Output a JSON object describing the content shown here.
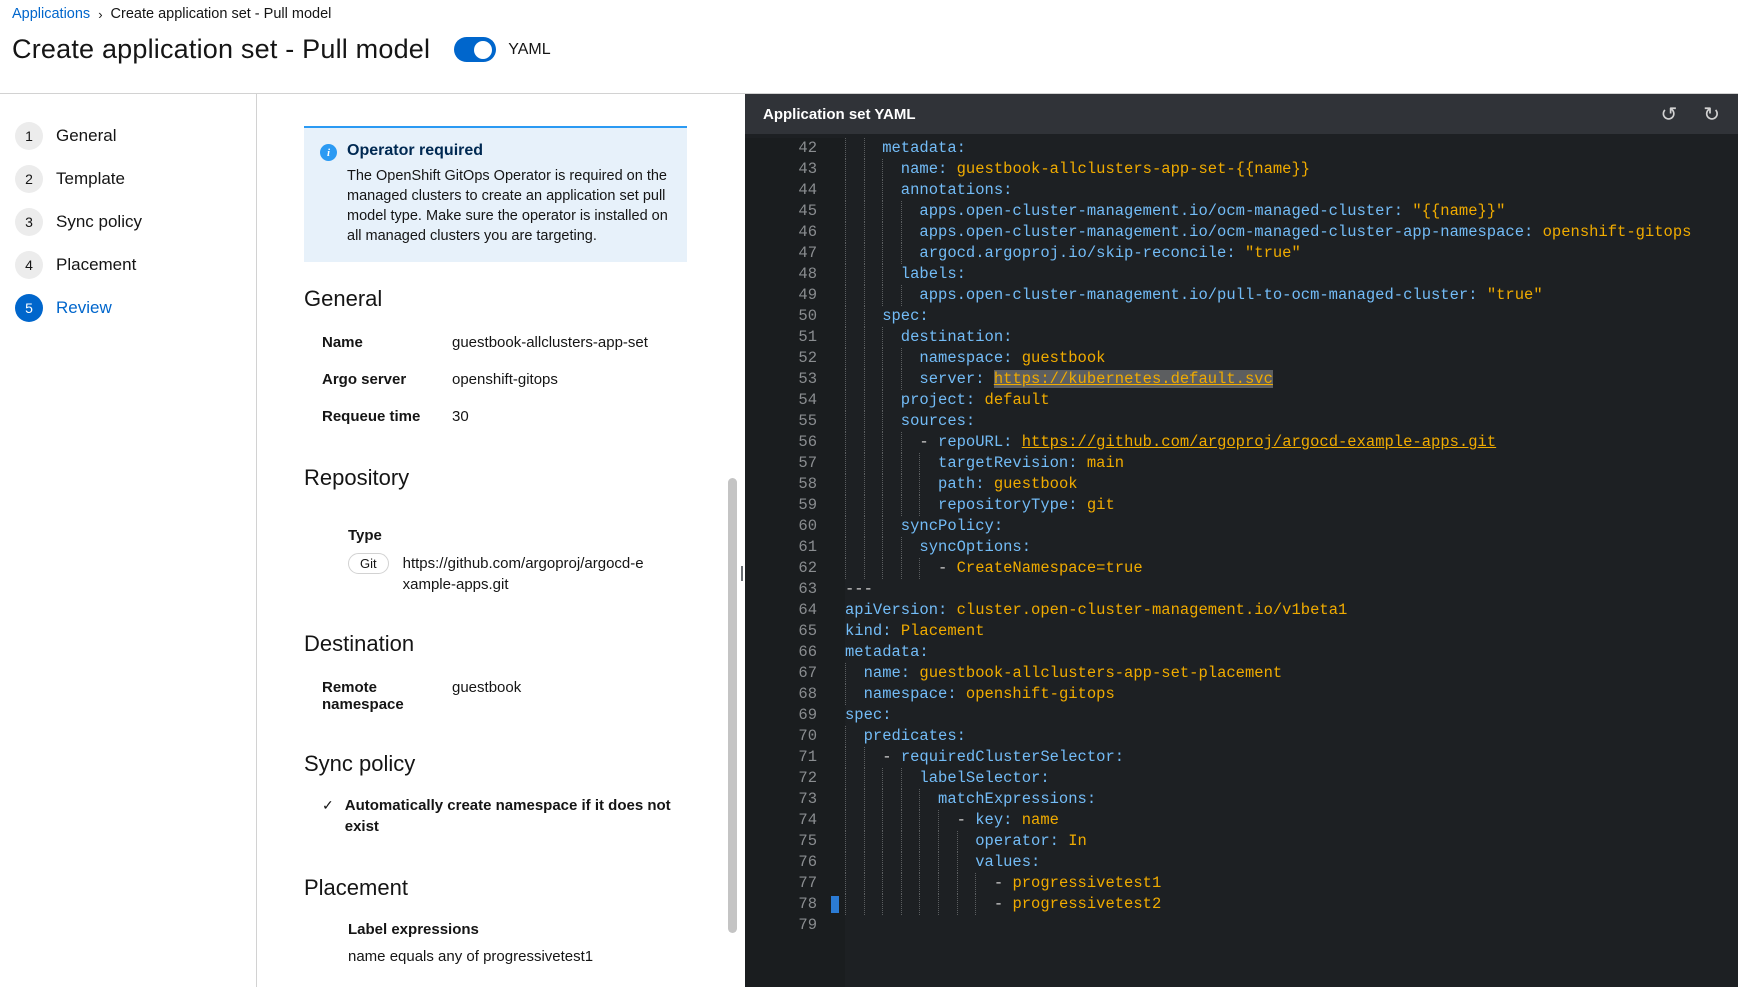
{
  "breadcrumb": {
    "link": "Applications",
    "separator": "›",
    "current": "Create application set - Pull model"
  },
  "header": {
    "title": "Create application set - Pull model",
    "toggle_label": "YAML",
    "toggle_on": true
  },
  "wizard": {
    "active_step": "5",
    "steps": [
      {
        "num": "1",
        "label": "General"
      },
      {
        "num": "2",
        "label": "Template"
      },
      {
        "num": "3",
        "label": "Sync policy"
      },
      {
        "num": "4",
        "label": "Placement"
      },
      {
        "num": "5",
        "label": "Review"
      }
    ]
  },
  "review": {
    "alert": {
      "icon": "info-circle-icon",
      "title": "Operator required",
      "body": "The OpenShift GitOps Operator is required on the managed clusters to create an application set pull model type. Make sure the operator is installed on all managed clusters you are targeting."
    },
    "general": {
      "heading": "General",
      "fields": [
        {
          "label": "Name",
          "value": "guestbook-allclusters-app-set"
        },
        {
          "label": "Argo server",
          "value": "openshift-gitops"
        },
        {
          "label": "Requeue time",
          "value": "30"
        }
      ]
    },
    "repository": {
      "heading": "Repository",
      "type_label": "Type",
      "type_chip": "Git",
      "url": "https://github.com/argoproj/argocd-example-apps.git"
    },
    "destination": {
      "heading": "Destination",
      "fields": [
        {
          "label": "Remote namespace",
          "value": "guestbook"
        }
      ]
    },
    "sync_policy": {
      "heading": "Sync policy",
      "check_glyph": "✓",
      "item": "Automatically create namespace if it does not exist"
    },
    "placement": {
      "heading": "Placement",
      "label": "Label expressions",
      "value_partial": "name equals any of progressivetest1"
    }
  },
  "editor": {
    "title": "Application set YAML",
    "undo_glyph": "↺",
    "redo_glyph": "↻",
    "cursor_line": 78,
    "colors": {
      "background": "#1d2023",
      "key": "#73bcf7",
      "value": "#f0ab00",
      "plain": "#d2d2d2",
      "line_number": "#8a8d90",
      "cursor": "#2b7bd4"
    },
    "lines": [
      {
        "n": 42,
        "s": [
          [
            "k",
            "    metadata:"
          ]
        ]
      },
      {
        "n": 43,
        "s": [
          [
            "k",
            "      name:"
          ],
          [
            "v",
            " guestbook-allclusters-app-set-{{name}}"
          ]
        ]
      },
      {
        "n": 44,
        "s": [
          [
            "k",
            "      annotations:"
          ]
        ]
      },
      {
        "n": 45,
        "s": [
          [
            "k",
            "        apps.open-cluster-management.io/ocm-managed-cluster:"
          ],
          [
            "v",
            " \"{{name}}\""
          ]
        ]
      },
      {
        "n": 46,
        "s": [
          [
            "k",
            "        apps.open-cluster-management.io/ocm-managed-cluster-app-namespace:"
          ],
          [
            "v",
            " openshift-gitops"
          ]
        ]
      },
      {
        "n": 47,
        "s": [
          [
            "k",
            "        argocd.argoproj.io/skip-reconcile:"
          ],
          [
            "v",
            " \"true\""
          ]
        ]
      },
      {
        "n": 48,
        "s": [
          [
            "k",
            "      labels:"
          ]
        ]
      },
      {
        "n": 49,
        "s": [
          [
            "k",
            "        apps.open-cluster-management.io/pull-to-ocm-managed-cluster:"
          ],
          [
            "v",
            " \"true\""
          ]
        ]
      },
      {
        "n": 50,
        "s": [
          [
            "k",
            "    spec:"
          ]
        ]
      },
      {
        "n": 51,
        "s": [
          [
            "k",
            "      destination:"
          ]
        ]
      },
      {
        "n": 52,
        "s": [
          [
            "k",
            "        namespace:"
          ],
          [
            "v",
            " guestbook"
          ]
        ]
      },
      {
        "n": 53,
        "s": [
          [
            "k",
            "        server:"
          ],
          [
            "p",
            " "
          ],
          [
            "h",
            "https://kubernetes.default.svc"
          ]
        ]
      },
      {
        "n": 54,
        "s": [
          [
            "k",
            "      project:"
          ],
          [
            "v",
            " default"
          ]
        ]
      },
      {
        "n": 55,
        "s": [
          [
            "k",
            "      sources:"
          ]
        ]
      },
      {
        "n": 56,
        "s": [
          [
            "p",
            "        - "
          ],
          [
            "k",
            "repoURL:"
          ],
          [
            "p",
            " "
          ],
          [
            "l",
            "https://github.com/argoproj/argocd-example-apps.git"
          ]
        ]
      },
      {
        "n": 57,
        "s": [
          [
            "k",
            "          targetRevision:"
          ],
          [
            "v",
            " main"
          ]
        ]
      },
      {
        "n": 58,
        "s": [
          [
            "k",
            "          path:"
          ],
          [
            "v",
            " guestbook"
          ]
        ]
      },
      {
        "n": 59,
        "s": [
          [
            "k",
            "          repositoryType:"
          ],
          [
            "v",
            " git"
          ]
        ]
      },
      {
        "n": 60,
        "s": [
          [
            "k",
            "      syncPolicy:"
          ]
        ]
      },
      {
        "n": 61,
        "s": [
          [
            "k",
            "        syncOptions:"
          ]
        ]
      },
      {
        "n": 62,
        "s": [
          [
            "p",
            "          - "
          ],
          [
            "v",
            "CreateNamespace=true"
          ]
        ]
      },
      {
        "n": 63,
        "s": [
          [
            "p",
            "---"
          ]
        ]
      },
      {
        "n": 64,
        "s": [
          [
            "k",
            "apiVersion:"
          ],
          [
            "v",
            " cluster.open-cluster-management.io/v1beta1"
          ]
        ]
      },
      {
        "n": 65,
        "s": [
          [
            "k",
            "kind:"
          ],
          [
            "v",
            " Placement"
          ]
        ]
      },
      {
        "n": 66,
        "s": [
          [
            "k",
            "metadata:"
          ]
        ]
      },
      {
        "n": 67,
        "s": [
          [
            "k",
            "  name:"
          ],
          [
            "v",
            " guestbook-allclusters-app-set-placement"
          ]
        ]
      },
      {
        "n": 68,
        "s": [
          [
            "k",
            "  namespace:"
          ],
          [
            "v",
            " openshift-gitops"
          ]
        ]
      },
      {
        "n": 69,
        "s": [
          [
            "k",
            "spec:"
          ]
        ]
      },
      {
        "n": 70,
        "s": [
          [
            "k",
            "  predicates:"
          ]
        ]
      },
      {
        "n": 71,
        "s": [
          [
            "p",
            "    - "
          ],
          [
            "k",
            "requiredClusterSelector:"
          ]
        ]
      },
      {
        "n": 72,
        "s": [
          [
            "k",
            "        labelSelector:"
          ]
        ]
      },
      {
        "n": 73,
        "s": [
          [
            "k",
            "          matchExpressions:"
          ]
        ]
      },
      {
        "n": 74,
        "s": [
          [
            "p",
            "            - "
          ],
          [
            "k",
            "key:"
          ],
          [
            "v",
            " name"
          ]
        ]
      },
      {
        "n": 75,
        "s": [
          [
            "k",
            "              operator:"
          ],
          [
            "v",
            " In"
          ]
        ]
      },
      {
        "n": 76,
        "s": [
          [
            "k",
            "              values:"
          ]
        ]
      },
      {
        "n": 77,
        "s": [
          [
            "p",
            "                - "
          ],
          [
            "v",
            "progressivetest1"
          ]
        ]
      },
      {
        "n": 78,
        "s": [
          [
            "p",
            "                - "
          ],
          [
            "v",
            "progressivetest2"
          ]
        ]
      },
      {
        "n": 79,
        "s": []
      }
    ]
  },
  "colors": {
    "accent": "#0066cc",
    "alert_bg": "#e7f1fa",
    "alert_border": "#2b9af3",
    "border": "#d2d2d2"
  }
}
